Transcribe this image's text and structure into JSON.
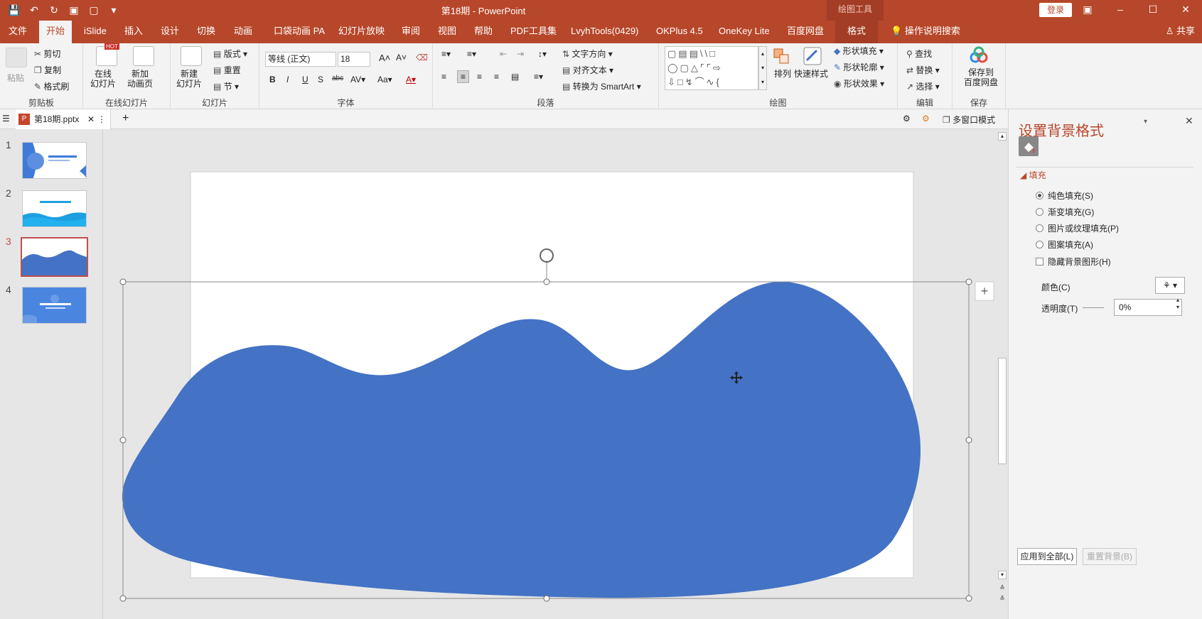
{
  "window": {
    "title": "第18期  -  PowerPoint",
    "context_tool": "绘图工具",
    "login": "登录"
  },
  "tabs": [
    "文件",
    "开始",
    "iSlide",
    "插入",
    "设计",
    "切换",
    "动画",
    "口袋动画 PA",
    "幻灯片放映",
    "审阅",
    "视图",
    "帮助",
    "PDF工具集",
    "LvyhTools(0429)",
    "OKPlus 4.5",
    "OneKey Lite",
    "百度网盘",
    "格式"
  ],
  "tell_me": "操作说明搜索",
  "share": "共享",
  "ribbon": {
    "clipboard": {
      "label": "剪贴板",
      "paste": "粘贴",
      "cut": "剪切",
      "copy": "复制",
      "format_painter": "格式刷"
    },
    "online": {
      "label": "在线幻灯片",
      "online_slides": "在线\n幻灯片",
      "hot": "HOT",
      "new_anim": "新加\n动画页"
    },
    "slides": {
      "label": "幻灯片",
      "new_slide": "新建\n幻灯片",
      "layout": "版式",
      "reset": "重置",
      "section": "节"
    },
    "font": {
      "label": "字体",
      "font_name": "等线 (正文)",
      "font_size": "18"
    },
    "paragraph": {
      "label": "段落",
      "text_direction": "文字方向",
      "align_text": "对齐文本",
      "smartart": "转换为 SmartArt"
    },
    "drawing": {
      "label": "绘图",
      "arrange": "排列",
      "quick_styles": "快速样式",
      "shape_fill": "形状填充",
      "shape_outline": "形状轮廓",
      "shape_effects": "形状效果"
    },
    "editing": {
      "label": "编辑",
      "find": "查找",
      "replace": "替换",
      "select": "选择"
    },
    "save": {
      "label": "保存",
      "save_to": "保存到\n百度网盘"
    }
  },
  "doc_tab": {
    "name": "第18期.pptx",
    "multiwindow": "多窗口模式"
  },
  "slides": [
    {
      "num": "1"
    },
    {
      "num": "2"
    },
    {
      "num": "3"
    },
    {
      "num": "4"
    }
  ],
  "pane": {
    "title": "设置背景格式",
    "section": "填充",
    "options": [
      "纯色填充(S)",
      "渐变填充(G)",
      "图片或纹理填充(P)",
      "图案填充(A)"
    ],
    "selected_option": "纯色填充(S)",
    "hide_bg": "隐藏背景图形(H)",
    "color_label": "颜色(C)",
    "transparency_label": "透明度(T)",
    "transparency_value": "0%",
    "apply_all": "应用到全部(L)",
    "reset_bg": "重置背景(B)"
  },
  "colors": {
    "accent": "#b7472a",
    "shape_fill": "#4472c4"
  }
}
